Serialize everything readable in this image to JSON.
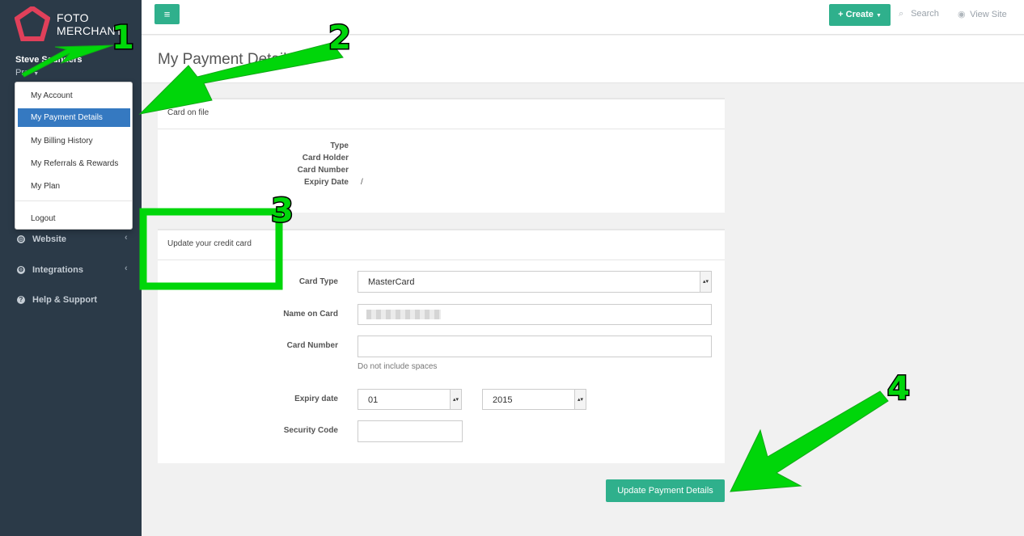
{
  "brand": {
    "line1": "FOTO",
    "line2": "MERCHANT"
  },
  "user": {
    "name": "Steve Saunders",
    "plan": "Pro"
  },
  "dropdown": {
    "items": [
      {
        "label": "My Account"
      },
      {
        "label": "My Payment Details",
        "active": true
      },
      {
        "label": "My Billing History"
      },
      {
        "label": "My Referrals & Rewards"
      },
      {
        "label": "My Plan"
      },
      {
        "label": "Logout"
      }
    ]
  },
  "sidebar": {
    "items": [
      {
        "label": "Website"
      },
      {
        "label": "Integrations"
      },
      {
        "label": "Help & Support"
      }
    ]
  },
  "topbar": {
    "create_label": "Create",
    "search_label": "Search",
    "view_site_label": "View Site"
  },
  "page": {
    "title": "My Payment Details"
  },
  "card_on_file": {
    "heading": "Card on file",
    "labels": {
      "type": "Type",
      "holder": "Card Holder",
      "number": "Card Number",
      "expiry": "Expiry Date"
    },
    "values": {
      "expiry": "/"
    }
  },
  "update_card": {
    "heading": "Update your credit card",
    "card_type_label": "Card Type",
    "card_type_value": "MasterCard",
    "name_label": "Name on Card",
    "number_label": "Card Number",
    "number_help": "Do not include spaces",
    "expiry_label": "Expiry date",
    "expiry_month": "01",
    "expiry_year": "2015",
    "security_label": "Security Code"
  },
  "submit_label": "Update Payment Details",
  "annotations": {
    "step1": "1",
    "step2": "2",
    "step3": "3",
    "step4": "4"
  },
  "colors": {
    "sidebar": "#2b3a48",
    "accent": "#2fb08c",
    "active": "#3579c1",
    "annotation": "#00d60a"
  }
}
